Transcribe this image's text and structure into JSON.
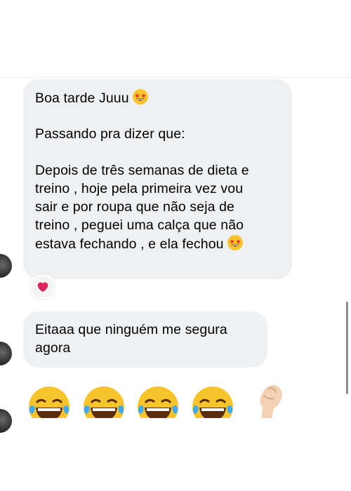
{
  "messages": [
    {
      "lines": [
        "Boa tarde Juuu",
        "",
        "Passando pra dizer que:",
        "",
        "Depois de três semanas de dieta e",
        "treino , hoje pela primeira vez vou",
        "sair e por roupa que não seja de",
        "treino , peguei uma calça que não",
        "estava fechando , e ela fechou"
      ],
      "emojis": [
        "star-struck-emoji",
        "star-struck-emoji"
      ],
      "reaction": "red-heart"
    },
    {
      "lines": [
        "Eitaaa que ninguém me segura",
        "agora"
      ]
    }
  ],
  "emoji_row": [
    "face-with-tears-of-joy",
    "face-with-tears-of-joy",
    "face-with-tears-of-joy",
    "face-with-tears-of-joy",
    "pinched-fingers"
  ],
  "colors": {
    "bubble": "#eff0f2",
    "heart": "#e0245e",
    "emoji": "#f7c52b"
  }
}
